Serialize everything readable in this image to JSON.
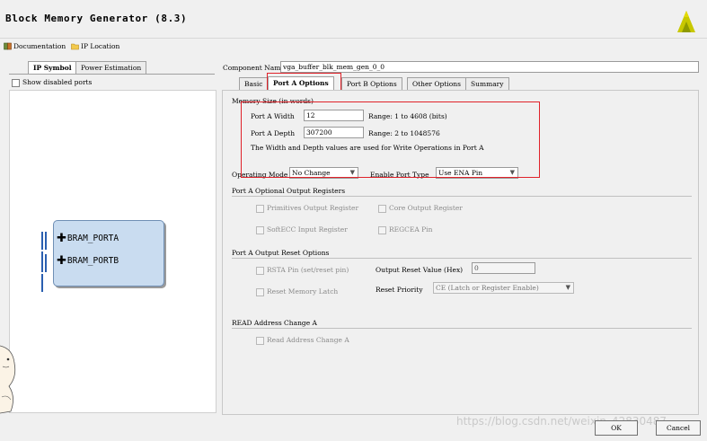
{
  "window": {
    "title": "Block Memory Generator (8.3)"
  },
  "toolbar": {
    "documentation": "Documentation",
    "ip_location": "IP Location"
  },
  "left_tabs": [
    "IP Symbol",
    "Power Estimation"
  ],
  "show_disabled_ports": "Show disabled ports",
  "ports": [
    "BRAM_PORTA",
    "BRAM_PORTB"
  ],
  "component_name": {
    "label": "Component Name",
    "value": "vga_buffer_blk_mem_gen_0_0"
  },
  "tabs": [
    "Basic",
    "Port A Options",
    "Port B Options",
    "Other Options",
    "Summary"
  ],
  "memory_size": {
    "section": "Memory Size (in words)",
    "width_label": "Port A Width",
    "width_value": "12",
    "width_range": "Range: 1 to 4608 (bits)",
    "depth_label": "Port A Depth",
    "depth_value": "307200",
    "depth_range": "Range: 2 to 1048576",
    "note": "The Width and Depth values are used for Write Operations in Port A"
  },
  "operating_mode": {
    "label": "Operating Mode",
    "value": "No Change"
  },
  "enable_port_type": {
    "label": "Enable Port Type",
    "value": "Use ENA Pin"
  },
  "optional_output_registers": {
    "section": "Port A Optional Output Registers",
    "primitives": "Primitives Output Register",
    "core": "Core Output Register",
    "softecc": "SoftECC Input Register",
    "regcea": "REGCEA Pin"
  },
  "output_reset": {
    "section": "Port A Output Reset Options",
    "rsta": "RSTA Pin (set/reset pin)",
    "reset_value_label": "Output Reset Value (Hex)",
    "reset_value": "0",
    "reset_memory_latch": "Reset Memory Latch",
    "reset_priority_label": "Reset Priority",
    "reset_priority_value": "CE (Latch or Register Enable)"
  },
  "read_address": {
    "section": "READ Address Change A",
    "checkbox": "Read Address Change A"
  },
  "buttons": {
    "ok": "OK",
    "cancel": "Cancel"
  },
  "watermark": "https://blog.csdn.net/weixin_42830487",
  "colors": {
    "highlight_red": "#e0222a",
    "port_blue": "#2a5fb0",
    "block_fill": "#c9dcf0"
  }
}
